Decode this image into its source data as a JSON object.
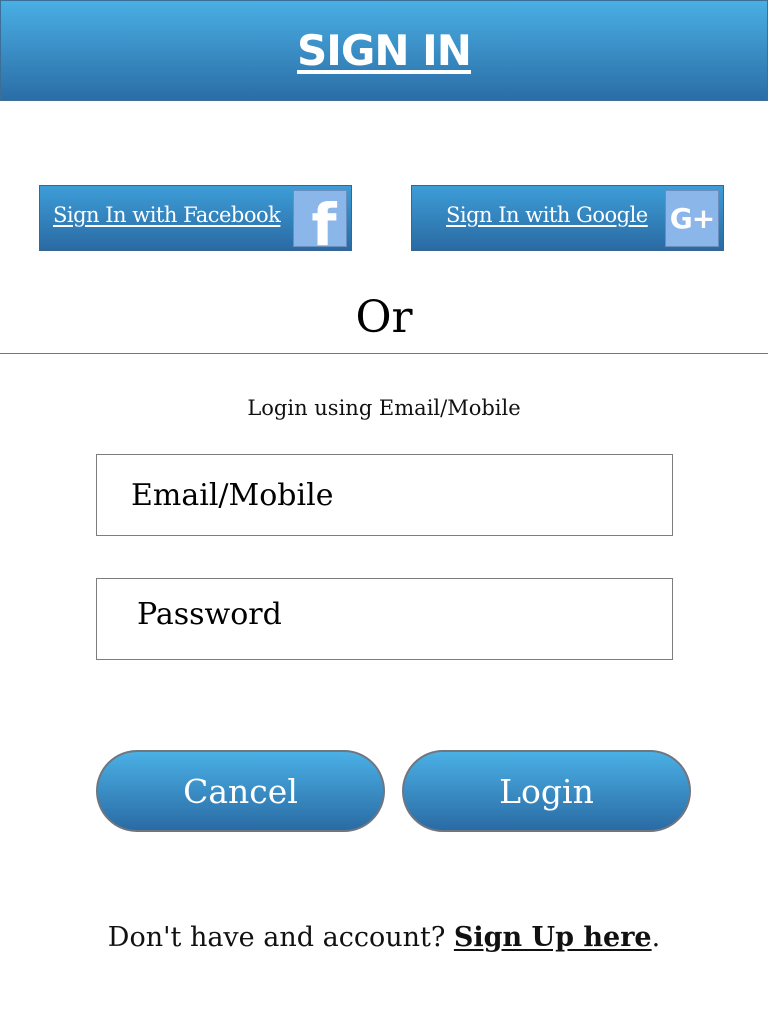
{
  "header": {
    "title": "SIGN IN"
  },
  "social": {
    "facebook": {
      "label": "Sign In with Facebook",
      "icon": "facebook-icon",
      "glyph": "f"
    },
    "google": {
      "label": "Sign In with Google",
      "icon": "google-plus-icon",
      "glyph": "G+"
    }
  },
  "separator": {
    "text": "Or"
  },
  "form": {
    "hint": "Login using Email/Mobile",
    "email_placeholder": "Email/Mobile",
    "password_placeholder": "Password"
  },
  "actions": {
    "cancel_label": "Cancel",
    "login_label": "Login"
  },
  "footer": {
    "prompt": "Don't have and account? ",
    "signup_link": "Sign Up here",
    "suffix": "."
  },
  "colors": {
    "button_gradient_top": "#49afe4",
    "button_gradient_bottom": "#2b6da6",
    "social_icon_bg": "#8bb6ea"
  }
}
